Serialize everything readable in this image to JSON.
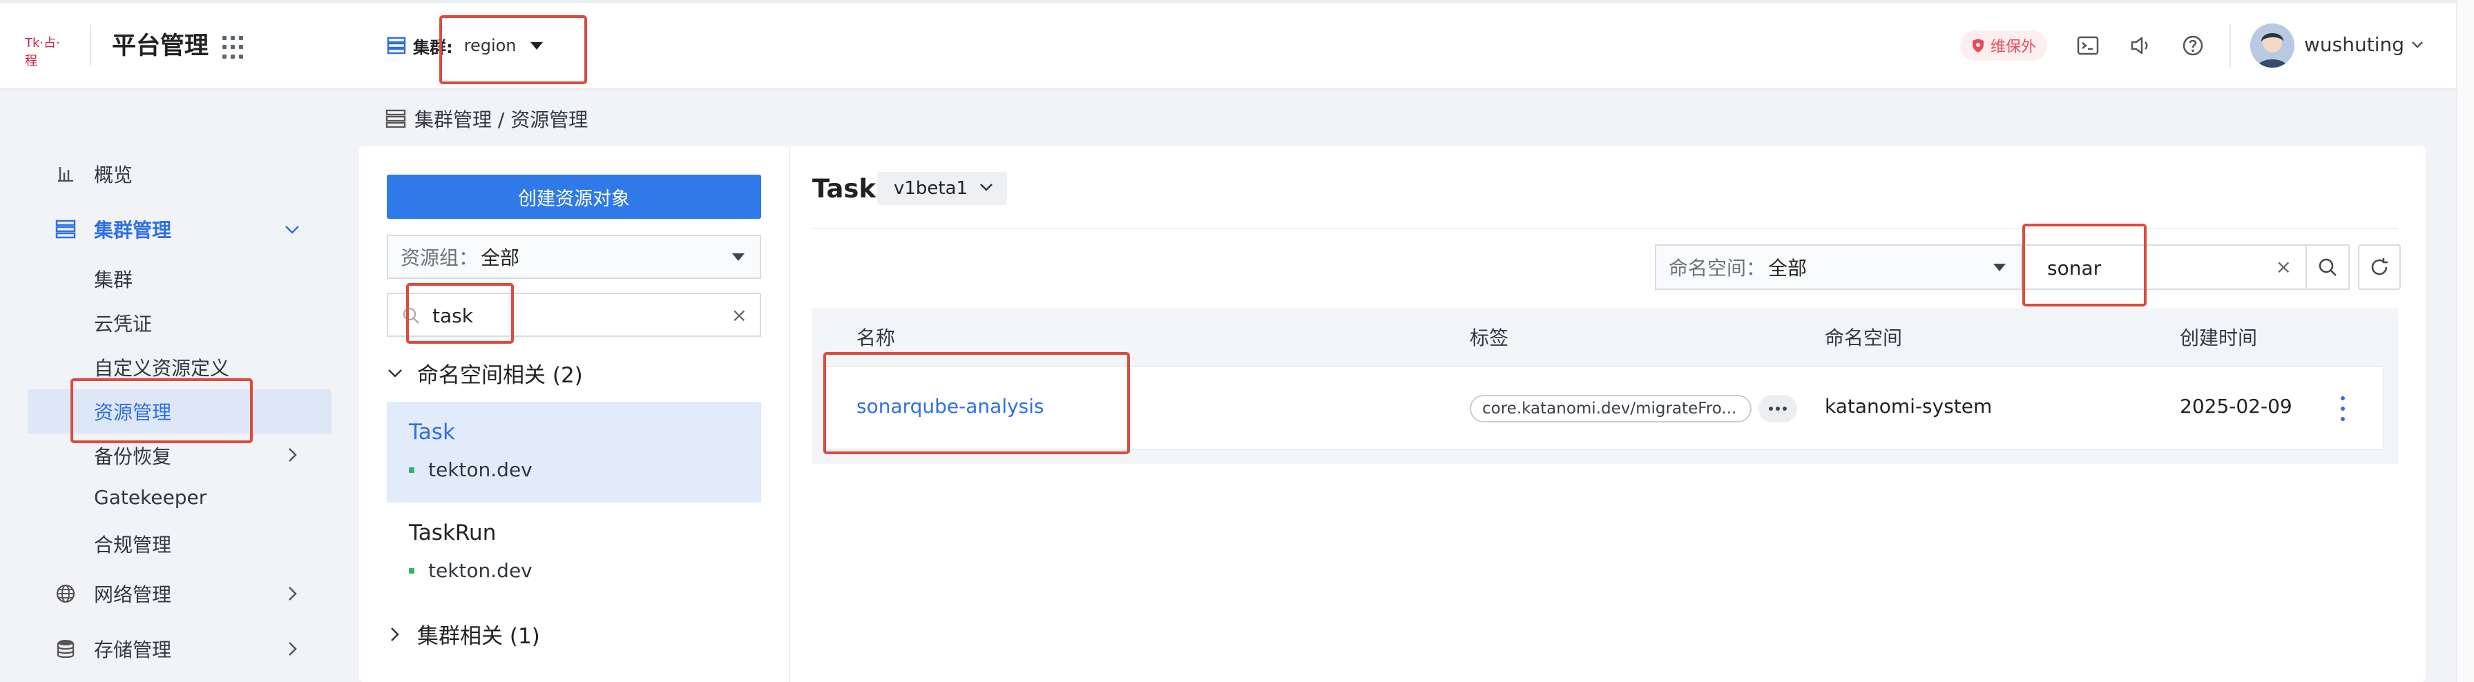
{
  "header": {
    "logo_text": "Tk·占·程",
    "platform_title": "平台管理",
    "cluster_label": "集群:",
    "cluster_value": "region",
    "maintenance_badge": "维保外",
    "username": "wushuting"
  },
  "sidebar": {
    "items": [
      {
        "label": "概览",
        "icon": "bar-chart-icon"
      },
      {
        "label": "集群管理",
        "icon": "cluster-icon",
        "active": true
      },
      {
        "label": "网络管理",
        "icon": "globe-icon"
      },
      {
        "label": "存储管理",
        "icon": "database-icon"
      }
    ],
    "subitems": [
      "集群",
      "云凭证",
      "自定义资源定义",
      "资源管理",
      "备份恢复",
      "Gatekeeper",
      "合规管理"
    ],
    "active_subitem": "资源管理"
  },
  "breadcrumb": "集群管理 / 资源管理",
  "left_panel": {
    "create_button": "创建资源对象",
    "resource_group_label": "资源组：",
    "resource_group_value": "全部",
    "filter_value": "task",
    "groups": [
      {
        "label": "命名空间相关 (2)",
        "expanded": true
      },
      {
        "label": "集群相关 (1)",
        "expanded": false
      }
    ],
    "resources": [
      {
        "name": "Task",
        "group": "tekton.dev",
        "selected": true
      },
      {
        "name": "TaskRun",
        "group": "tekton.dev",
        "selected": false
      }
    ]
  },
  "main": {
    "kind_title": "Task",
    "version": "v1beta1",
    "namespace_label": "命名空间：",
    "namespace_value": "全部",
    "search_value": "sonar",
    "columns": [
      "名称",
      "标签",
      "命名空间",
      "创建时间"
    ],
    "rows": [
      {
        "name": "sonarqube-analysis",
        "label": "core.katanomi.dev/migrateFro...",
        "namespace": "katanomi-system",
        "created": "2025-02-09"
      }
    ]
  },
  "colors": {
    "primary": "#2f7ae8",
    "link": "#2f6fe8",
    "danger": "#ec4b5a",
    "highlight": "#dd4b3c",
    "sidebar_active_bg": "#dde7f8"
  }
}
